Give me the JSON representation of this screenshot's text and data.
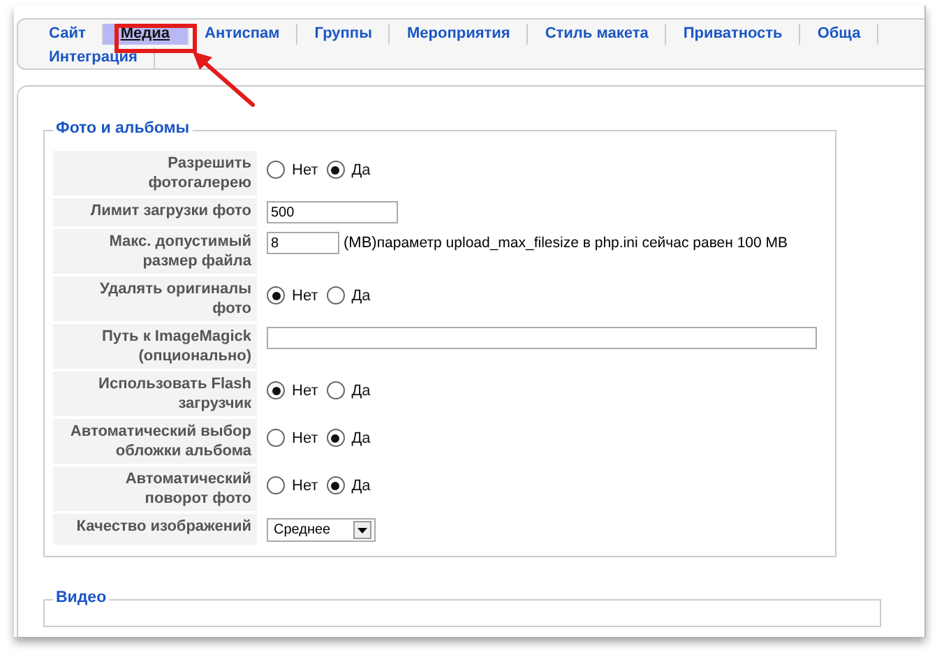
{
  "tab_rows": [
    [
      {
        "label": "Сайт",
        "selected": false
      },
      {
        "label": "Медиа",
        "selected": true
      },
      {
        "label": "Антиспам",
        "selected": false
      },
      {
        "label": "Группы",
        "selected": false
      },
      {
        "label": "Мероприятия",
        "selected": false
      },
      {
        "label": "Стиль макета",
        "selected": false
      },
      {
        "label": "Приватность",
        "selected": false
      },
      {
        "label": "Обща",
        "selected": false
      }
    ],
    [
      {
        "label": "Интеграция",
        "selected": false
      }
    ]
  ],
  "fieldsets": [
    {
      "legend": "Фото и альбомы",
      "rows": [
        {
          "label": "Разрешить фотогалерею",
          "kind": "radio",
          "options": [
            {
              "label": "Нет",
              "selected": false
            },
            {
              "label": "Да",
              "selected": true
            }
          ]
        },
        {
          "label": "Лимит загрузки фото",
          "kind": "text",
          "value": "500"
        },
        {
          "label": "Макс. допустимый размер файла",
          "kind": "unit",
          "value": "8",
          "unit": "(MB)",
          "note": "параметр upload_max_filesize в php.ini сейчас равен 100 MB"
        },
        {
          "label": "Удалять оригиналы фото",
          "kind": "radio",
          "options": [
            {
              "label": "Нет",
              "selected": true
            },
            {
              "label": "Да",
              "selected": false
            }
          ]
        },
        {
          "label": "Путь к ImageMagick (опционально)",
          "kind": "path"
        },
        {
          "label": "Использовать Flash загрузчик",
          "kind": "radio",
          "options": [
            {
              "label": "Нет",
              "selected": true
            },
            {
              "label": "Да",
              "selected": false
            }
          ]
        },
        {
          "label": "Автоматический выбор обложки альбома",
          "kind": "radio",
          "options": [
            {
              "label": "Нет",
              "selected": false
            },
            {
              "label": "Да",
              "selected": true
            }
          ]
        },
        {
          "label": "Автоматический поворот фото",
          "kind": "radio",
          "options": [
            {
              "label": "Нет",
              "selected": false
            },
            {
              "label": "Да",
              "selected": true
            }
          ]
        },
        {
          "label": "Качество изображений",
          "kind": "select",
          "value": "Среднее"
        }
      ]
    },
    {
      "legend": "Видео"
    }
  ]
}
